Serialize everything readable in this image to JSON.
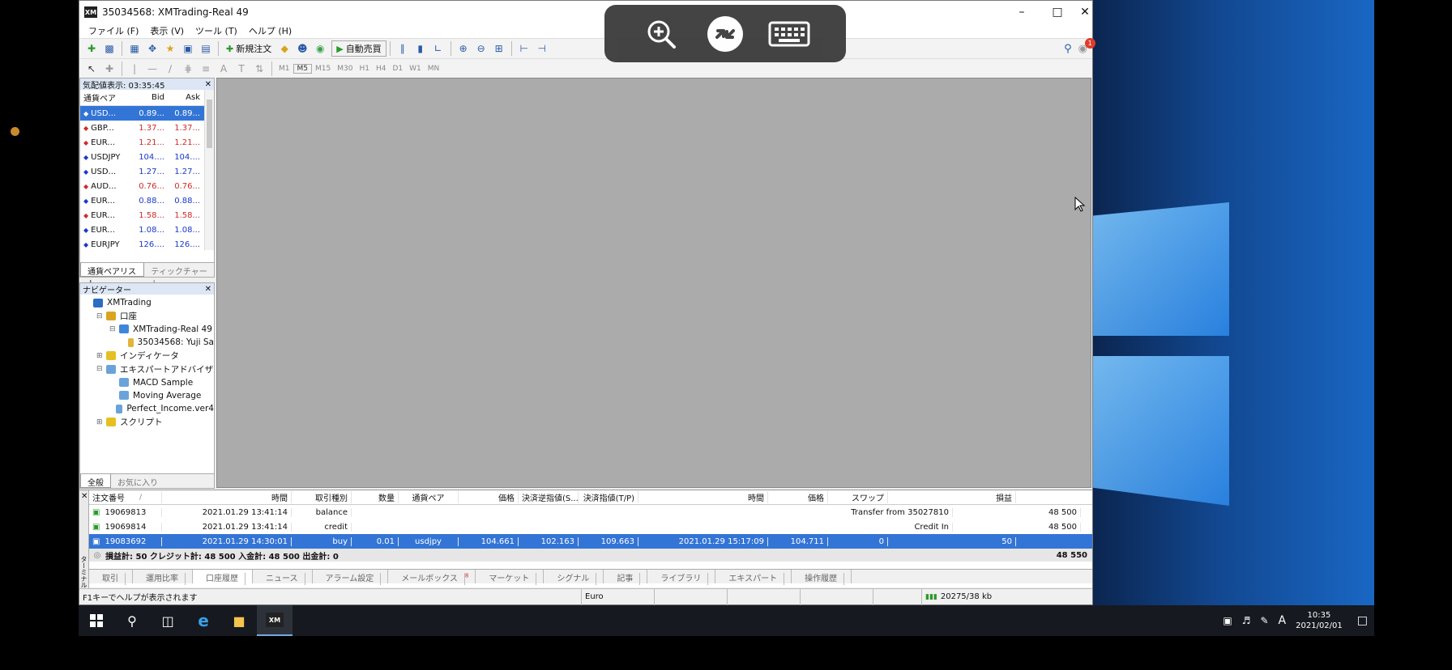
{
  "window": {
    "title": "35034568: XMTrading-Real 49",
    "logo_text": "XM"
  },
  "menu": [
    "ファイル (F)",
    "表示 (V)",
    "ツール (T)",
    "ヘルプ (H)"
  ],
  "toolbar": {
    "new_order_label": "新規注文",
    "auto_trade_label": "自動売買",
    "timeframes": [
      "M1",
      "M5",
      "M15",
      "M30",
      "H1",
      "H4",
      "D1",
      "W1",
      "MN"
    ],
    "notification_count": "1"
  },
  "market_watch": {
    "title": "気配値表示: 03:35:45",
    "headers": {
      "symbol": "通貨ペア",
      "bid": "Bid",
      "ask": "Ask"
    },
    "rows": [
      {
        "symbol": "USD...",
        "bid": "0.89...",
        "ask": "0.89...",
        "dir": "up"
      },
      {
        "symbol": "GBP...",
        "bid": "1.37...",
        "ask": "1.37...",
        "dir": "dn"
      },
      {
        "symbol": "EUR...",
        "bid": "1.21...",
        "ask": "1.21...",
        "dir": "dn"
      },
      {
        "symbol": "USDJPY",
        "bid": "104....",
        "ask": "104....",
        "dir": "up"
      },
      {
        "symbol": "USD...",
        "bid": "1.27...",
        "ask": "1.27...",
        "dir": "up"
      },
      {
        "symbol": "AUD...",
        "bid": "0.76...",
        "ask": "0.76...",
        "dir": "dn"
      },
      {
        "symbol": "EUR...",
        "bid": "0.88...",
        "ask": "0.88...",
        "dir": "up"
      },
      {
        "symbol": "EUR...",
        "bid": "1.58...",
        "ask": "1.58...",
        "dir": "dn"
      },
      {
        "symbol": "EUR...",
        "bid": "1.08...",
        "ask": "1.08...",
        "dir": "up"
      },
      {
        "symbol": "EURJPY",
        "bid": "126....",
        "ask": "126....",
        "dir": "up"
      }
    ],
    "tabs": [
      "通貨ペアリスト",
      "ティックチャート"
    ]
  },
  "navigator": {
    "title": "ナビゲーター",
    "items": [
      {
        "label": "XMTrading",
        "indent": 0,
        "pm": "",
        "color": "#2d6cc4"
      },
      {
        "label": "口座",
        "indent": 1,
        "pm": "⊟",
        "color": "#d9a520"
      },
      {
        "label": "XMTrading-Real 49",
        "indent": 2,
        "pm": "⊟",
        "color": "#3f86d9"
      },
      {
        "label": "35034568: Yuji Sa",
        "indent": 3,
        "pm": "",
        "color": "#e2b43a"
      },
      {
        "label": "インディケータ",
        "indent": 1,
        "pm": "⊞",
        "color": "#e6c020"
      },
      {
        "label": "エキスパートアドバイザ",
        "indent": 1,
        "pm": "⊟",
        "color": "#6aa3d9"
      },
      {
        "label": "MACD Sample",
        "indent": 2,
        "pm": "",
        "color": "#6aa3d9"
      },
      {
        "label": "Moving Average",
        "indent": 2,
        "pm": "",
        "color": "#6aa3d9"
      },
      {
        "label": "Perfect_Income.ver4",
        "indent": 2,
        "pm": "",
        "color": "#6aa3d9"
      },
      {
        "label": "スクリプト",
        "indent": 1,
        "pm": "⊞",
        "color": "#e6c020"
      }
    ],
    "tabs": [
      "全般",
      "お気に入り"
    ]
  },
  "terminal": {
    "side_label": "ターミナル",
    "headers": [
      "注文番号",
      "時間",
      "取引種別",
      "数量",
      "通貨ペア",
      "価格",
      "決済逆指値(S...",
      "決済指値(T/P)",
      "時間",
      "価格",
      "スワップ",
      "損益"
    ],
    "sort_mark": "/",
    "rows": [
      {
        "ticket": "19069813",
        "time": "2021.01.29 13:41:14",
        "type": "balance",
        "comment": "Transfer from 35027810",
        "profit": "48 500",
        "sel": false
      },
      {
        "ticket": "19069814",
        "time": "2021.01.29 13:41:14",
        "type": "credit",
        "comment": "Credit In",
        "profit": "48 500",
        "sel": false
      },
      {
        "ticket": "19083692",
        "time": "2021.01.29 14:30:01",
        "type": "buy",
        "size": "0.01",
        "symbol": "usdjpy",
        "price": "104.661",
        "sl": "102.163",
        "tp": "109.663",
        "close_time": "2021.01.29 15:17:09",
        "close_price": "104.711",
        "swap": "0",
        "profit": "50",
        "sel": true
      }
    ],
    "summary": "損益計: 50 クレジット計: 48 500 入金計: 48 500 出金計: 0",
    "summary_total": "48 550",
    "tabs": [
      "取引",
      "運用比率",
      "口座履歴",
      "ニュース",
      "アラーム設定",
      "メールボックス",
      "マーケット",
      "シグナル",
      "記事",
      "ライブラリ",
      "エキスパート",
      "操作履歴"
    ],
    "mail_badge": "8"
  },
  "statusbar": {
    "help": "F1キーでヘルプが表示されます",
    "profile": "Euro",
    "traffic": "20275/38 kb"
  },
  "taskbar": {
    "time": "10:35",
    "date": "2021/02/01",
    "ime": "A"
  }
}
